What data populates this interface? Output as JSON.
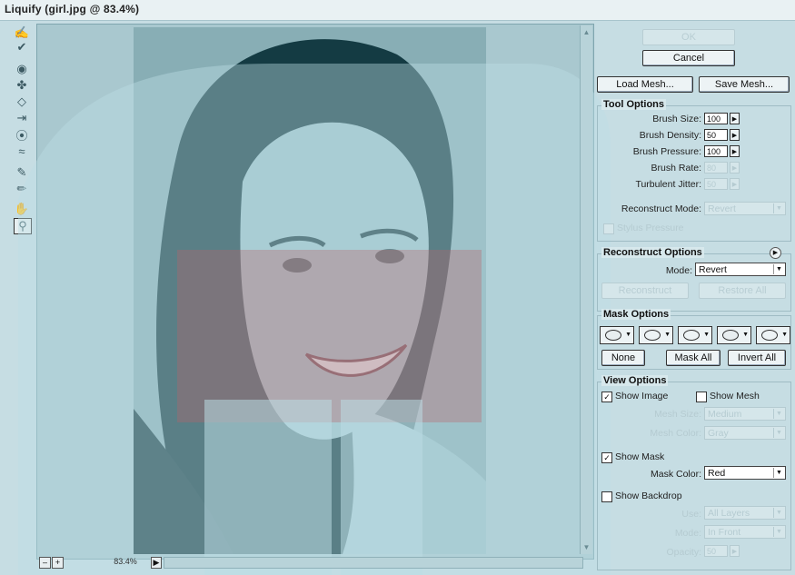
{
  "window": {
    "title": "Liquify (girl.jpg @ 83.4%)"
  },
  "toolbar": {
    "tools": [
      {
        "name": "forward-warp-tool",
        "glyph": "✍"
      },
      {
        "name": "reconstruct-tool",
        "glyph": "✔"
      },
      {
        "name": "twirl-clockwise-tool",
        "glyph": "◉"
      },
      {
        "name": "pucker-tool",
        "glyph": "✤"
      },
      {
        "name": "bloat-tool",
        "glyph": "◇"
      },
      {
        "name": "push-left-tool",
        "glyph": "⇥"
      },
      {
        "name": "mirror-tool",
        "glyph": "⦿"
      },
      {
        "name": "turbulence-tool",
        "glyph": "≈"
      },
      {
        "name": "freeze-mask-tool",
        "glyph": "✎"
      },
      {
        "name": "thaw-mask-tool",
        "glyph": "✏"
      },
      {
        "name": "hand-tool",
        "glyph": "✋"
      },
      {
        "name": "zoom-tool",
        "glyph": "⚲"
      }
    ]
  },
  "status": {
    "zoom_out": "–",
    "zoom_in": "+",
    "zoom": "83.4%",
    "menu": "▶"
  },
  "buttons": {
    "ok": "OK",
    "cancel": "Cancel",
    "load_mesh": "Load Mesh...",
    "save_mesh": "Save Mesh..."
  },
  "tool_options": {
    "title": "Tool Options",
    "brush_size": {
      "label": "Brush Size:",
      "value": "100"
    },
    "brush_density": {
      "label": "Brush Density:",
      "value": "50"
    },
    "brush_pressure": {
      "label": "Brush Pressure:",
      "value": "100"
    },
    "brush_rate": {
      "label": "Brush Rate:",
      "value": "80"
    },
    "turbulent_jitter": {
      "label": "Turbulent Jitter:",
      "value": "50"
    },
    "reconstruct_mode": {
      "label": "Reconstruct Mode:",
      "value": "Revert"
    },
    "stylus_pressure": "Stylus Pressure"
  },
  "reconstruct_options": {
    "title": "Reconstruct Options",
    "mode_label": "Mode:",
    "mode_value": "Revert",
    "reconstruct": "Reconstruct",
    "restore_all": "Restore All"
  },
  "mask_options": {
    "title": "Mask Options",
    "none": "None",
    "mask_all": "Mask All",
    "invert_all": "Invert All"
  },
  "view_options": {
    "title": "View Options",
    "show_image": "Show Image",
    "show_image_checked": "✓",
    "show_mesh": "Show Mesh",
    "mesh_size_label": "Mesh Size:",
    "mesh_size_value": "Medium",
    "mesh_color_label": "Mesh Color:",
    "mesh_color_value": "Gray",
    "show_mask": "Show Mask",
    "show_mask_checked": "✓",
    "mask_color_label": "Mask Color:",
    "mask_color_value": "Red",
    "show_backdrop": "Show Backdrop",
    "use_label": "Use:",
    "use_value": "All Layers",
    "mode_label": "Mode:",
    "mode_value": "In Front",
    "opacity_label": "Opacity:",
    "opacity_value": "50"
  },
  "colors": {
    "background": "#c6dde3",
    "mask": "#b9646a"
  }
}
